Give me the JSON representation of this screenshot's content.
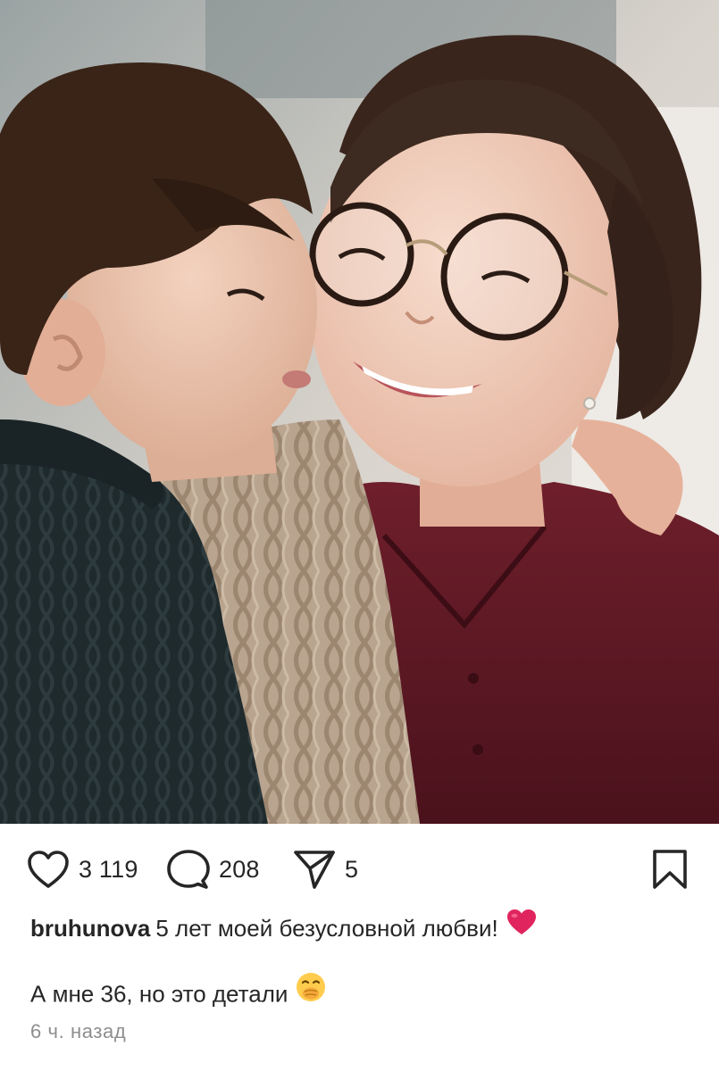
{
  "post": {
    "image_alt": "Selfie of a smiling woman with round glasses and a young boy kissing her cheek",
    "likes": "3 119",
    "comments": "208",
    "shares": "5",
    "username": "bruhunova",
    "caption_line1": "5 лет моей безусловной любви!",
    "caption_line2": "А мне 36, но это детали",
    "timestamp": "6 ч. назад"
  },
  "icons": {
    "like": "heart-outline-icon",
    "comment": "speech-bubble-icon",
    "share": "paper-plane-icon",
    "save": "bookmark-icon",
    "emoji1": "red-heart-emoji",
    "emoji2": "hand-over-mouth-emoji"
  },
  "colors": {
    "text": "#262626",
    "muted": "#8e8e8e",
    "heart": "#e0245e"
  }
}
